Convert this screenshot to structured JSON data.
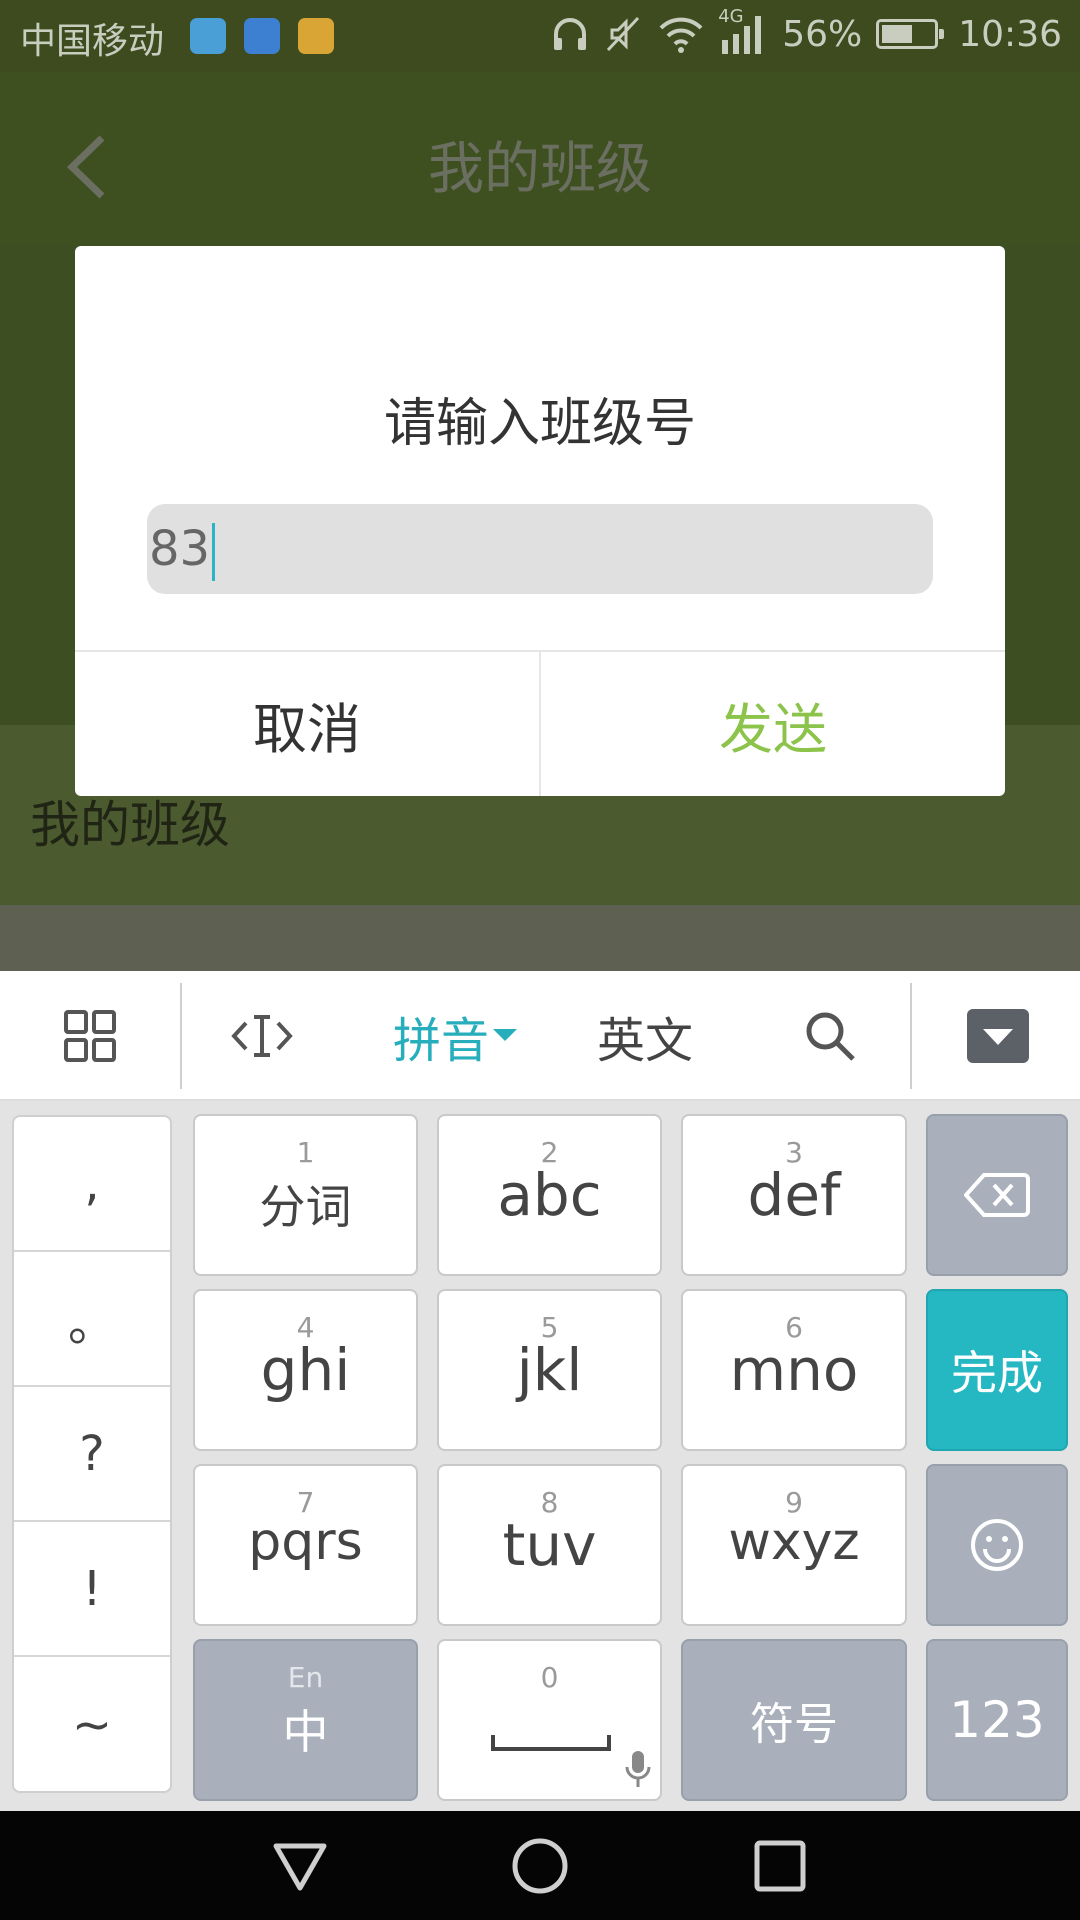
{
  "status_bar": {
    "carrier": "中国移动",
    "network": "4G",
    "battery": "56%",
    "time": "10:36"
  },
  "app": {
    "title": "我的班级",
    "section_label": "我的班级"
  },
  "dialog": {
    "title": "请输入班级号",
    "input_value": "83",
    "cancel": "取消",
    "send": "发送"
  },
  "keyboard": {
    "toolbar": {
      "pinyin": "拼音",
      "english": "英文"
    },
    "punctuation": [
      ",",
      "。",
      "?",
      "!",
      "~"
    ],
    "keys": [
      {
        "num": "1",
        "label": "分词"
      },
      {
        "num": "2",
        "label": "abc"
      },
      {
        "num": "3",
        "label": "def"
      },
      {
        "num": "4",
        "label": "ghi"
      },
      {
        "num": "5",
        "label": "jkl"
      },
      {
        "num": "6",
        "label": "mno"
      },
      {
        "num": "7",
        "label": "pqrs"
      },
      {
        "num": "8",
        "label": "tuv"
      },
      {
        "num": "9",
        "label": "wxyz"
      }
    ],
    "done": "完成",
    "lang_small": "En",
    "lang_main": "中",
    "zero": "0",
    "symbols": "符号",
    "numbers": "123"
  },
  "colors": {
    "accent_teal": "#25b8c3",
    "send_green": "#8cc34a",
    "app_green": "#3d4e22"
  }
}
